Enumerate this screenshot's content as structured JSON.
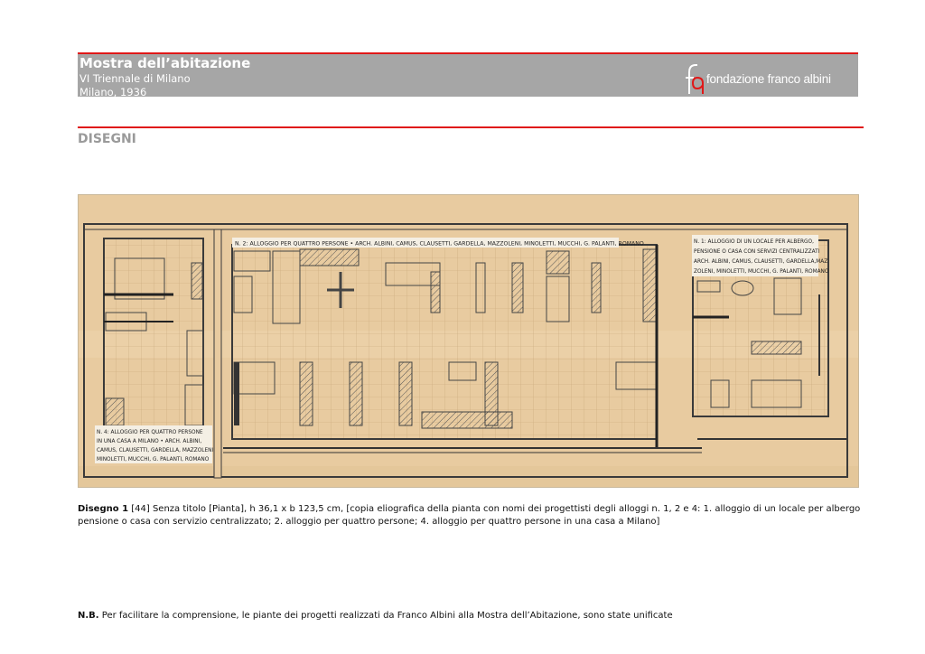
{
  "header": {
    "title": "Mostra dell’abitazione",
    "subtitle_1": "VI Triennale di Milano",
    "subtitle_2": "Milano, 1936",
    "logo_mark": "fa",
    "logo_text": "fondazione franco albini"
  },
  "section": {
    "title": "DISEGNI"
  },
  "plan": {
    "label_n2": "N. 2: ALLOGGIO PER QUATTRO PERSONE  • ARCH. ALBINI, CAMUS, CLAUSETTI, GARDELLA, MAZZOLENI, MINOLETTI, MUCCHI, G. PALANTI, ROMANO",
    "label_n1_lines": [
      "N. 1: ALLOGGIO DI UN LOCALE PER  ALBERGO,",
      "PENSIONE O CASA CON SERVIZI CENTRALIZZATI",
      "ARCH. ALBINI, CAMUS, CLAUSETTI, GARDELLA,MAZ",
      "ZOLENI, MINOLETTI, MUCCHI, G. PALANTI, ROMANO"
    ],
    "label_n4_lines": [
      "N. 4: ALLOGGIO PER QUATTRO PERSONE",
      "IN UNA CASA A MILANO • ARCH. ALBINI,",
      "CAMUS, CLAUSETTI, GARDELLA, MAZZOLENI",
      "MINOLETTI, MUCCHI, G. PALANTI, ROMANO"
    ]
  },
  "caption": {
    "label": "Disegno 1",
    "text": " [44] Senza titolo [Pianta], h 36,1 x b 123,5 cm, [copia eliografica della pianta con nomi dei progettisti degli alloggi n. 1, 2 e 4: 1. alloggio di un locale per albergo pensione o casa con servizio centralizzato; 2. alloggio per quattro persone; 4. alloggio per quattro persone in una casa a Milano]"
  },
  "note": {
    "label": "N.B.",
    "text": " Per facilitare la comprensione, le piante dei progetti realizzati da Franco Albini alla Mostra dell’Abitazione,  sono state unificate"
  },
  "colors": {
    "accent_red": "#e01818",
    "header_gray": "#a6a6a6",
    "section_gray": "#9a9a9a",
    "paper": "#e9cda4",
    "ink": "#3a3a3a"
  }
}
